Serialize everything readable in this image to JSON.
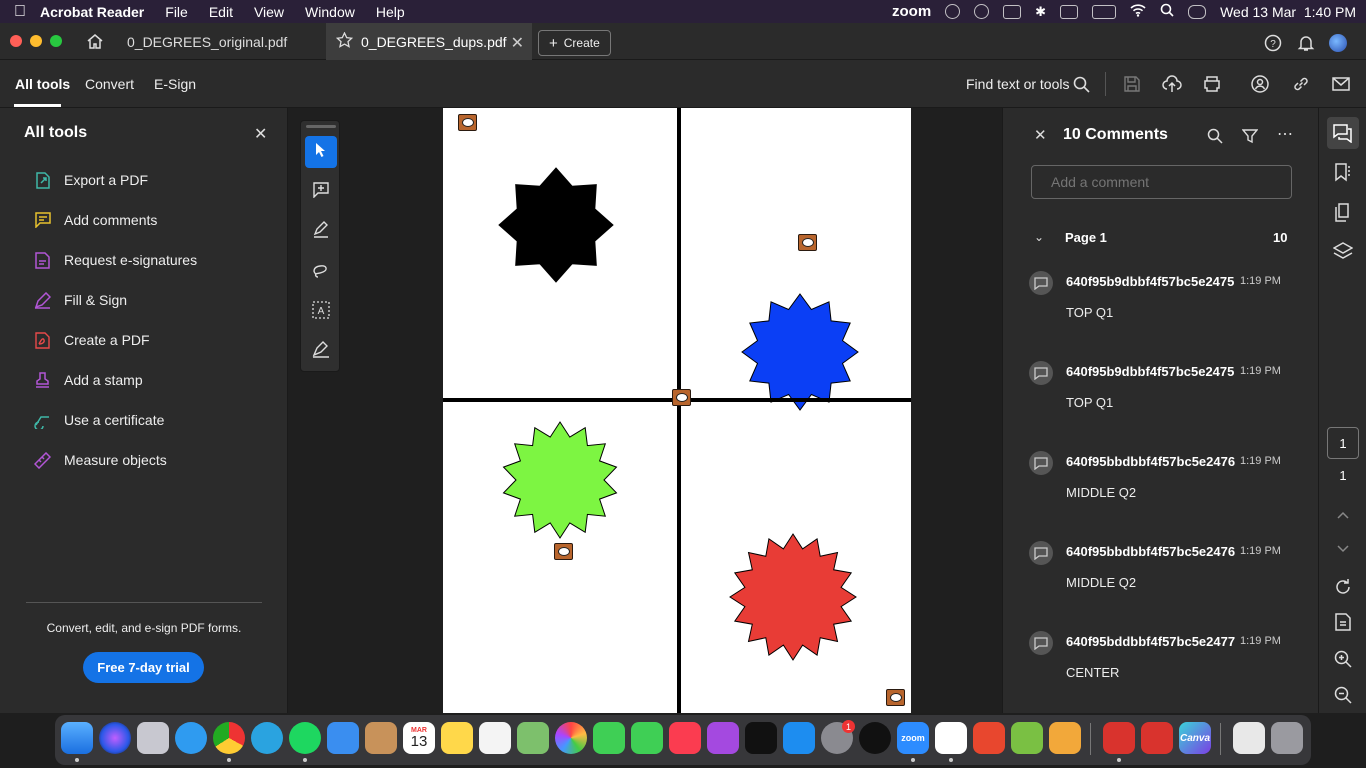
{
  "menubar": {
    "app_name": "Acrobat Reader",
    "items": [
      "File",
      "Edit",
      "View",
      "Window",
      "Help"
    ],
    "zoom_label": "zoom",
    "datetime": "Wed 13 Mar  1:40 PM"
  },
  "tabs": [
    {
      "label": "0_DEGREES_original.pdf"
    },
    {
      "label": "0_DEGREES_dups.pdf"
    }
  ],
  "create_label": "Create",
  "toolbar": {
    "tabs": [
      "All tools",
      "Convert",
      "E-Sign"
    ],
    "find_label": "Find text or tools"
  },
  "all_tools": {
    "title": "All tools",
    "items": [
      {
        "label": "Export a PDF",
        "icon": "export-pdf-icon",
        "color": "#3fb8a8"
      },
      {
        "label": "Add comments",
        "icon": "add-comment-icon",
        "color": "#e8c22e"
      },
      {
        "label": "Request e-signatures",
        "icon": "request-signature-icon",
        "color": "#b256d6"
      },
      {
        "label": "Fill & Sign",
        "icon": "fill-sign-icon",
        "color": "#b256d6"
      },
      {
        "label": "Create a PDF",
        "icon": "create-pdf-icon",
        "color": "#e84a4a"
      },
      {
        "label": "Add a stamp",
        "icon": "stamp-icon",
        "color": "#b256d6"
      },
      {
        "label": "Use a certificate",
        "icon": "certificate-icon",
        "color": "#3fb8a8"
      },
      {
        "label": "Measure objects",
        "icon": "measure-icon",
        "color": "#b256d6"
      }
    ],
    "promo_text": "Convert, edit, and e-sign PDF forms.",
    "trial_button": "Free 7-day trial"
  },
  "document": {
    "shapes": [
      {
        "name": "black-star",
        "fill": "#000000",
        "points": 8
      },
      {
        "name": "blue-star",
        "fill": "#0b3ff5",
        "points": 12
      },
      {
        "name": "green-star",
        "fill": "#7df542",
        "points": 14
      },
      {
        "name": "red-star",
        "fill": "#e83c36",
        "points": 16
      }
    ],
    "comment_marker_color": "#b8652d"
  },
  "comments_panel": {
    "title": "10 Comments",
    "input_placeholder": "Add a comment",
    "page_label": "Page 1",
    "page_count": "10",
    "comments": [
      {
        "author": "640f95b9dbbf4f57bc5e2475",
        "time": "1:19 PM",
        "text": "TOP Q1"
      },
      {
        "author": "640f95b9dbbf4f57bc5e2475",
        "time": "1:19 PM",
        "text": "TOP Q1"
      },
      {
        "author": "640f95bbdbbf4f57bc5e2476",
        "time": "1:19 PM",
        "text": "MIDDLE Q2"
      },
      {
        "author": "640f95bbdbbf4f57bc5e2476",
        "time": "1:19 PM",
        "text": "MIDDLE Q2"
      },
      {
        "author": "640f95bddbbf4f57bc5e2477",
        "time": "1:19 PM",
        "text": "CENTER"
      }
    ]
  },
  "page_nav": {
    "current": "1",
    "total": "1"
  },
  "dock": {
    "calendar_month": "MAR",
    "calendar_day": "13",
    "settings_badge": "1",
    "zoom_label": "zoom",
    "canva_label": "Canva"
  }
}
